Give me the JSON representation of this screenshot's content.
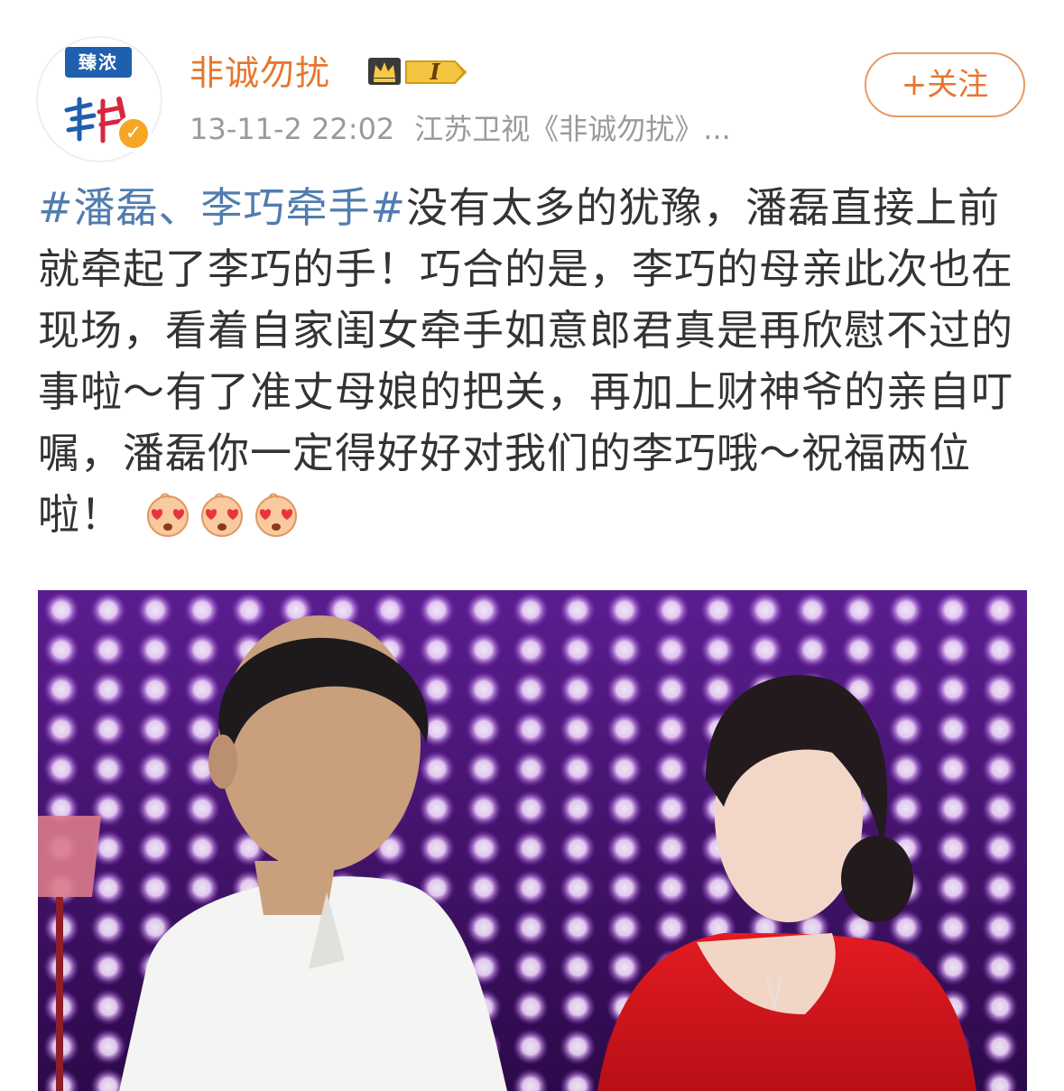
{
  "account": {
    "avatar_brand": "臻浓",
    "name": "非诚勿扰",
    "level": "I",
    "timestamp": "13-11-2 22:02",
    "source": "江苏卫视《非诚勿扰》...",
    "verified_mark": "✓"
  },
  "follow_button": {
    "label": "+关注"
  },
  "post": {
    "hashtag": "#潘磊、李巧牵手#",
    "body": "没有太多的犹豫，潘磊直接上前就牵起了李巧的手！巧合的是，李巧的母亲此次也在现场，看着自家闺女牵手如意郎君真是再欣慰不过的事啦～有了准丈母娘的把关，再加上财神爷的亲自叮嘱，潘磊你一定得好好对我们的李巧哦～祝福两位啦！",
    "emojis": [
      "heart-eyes-emoji",
      "heart-eyes-emoji",
      "heart-eyes-emoji"
    ]
  },
  "colors": {
    "name": "#e8762d",
    "hashtag": "#507daf",
    "meta": "#9a9a9a",
    "follow_border": "#e89a62",
    "verified": "#f6a623"
  }
}
